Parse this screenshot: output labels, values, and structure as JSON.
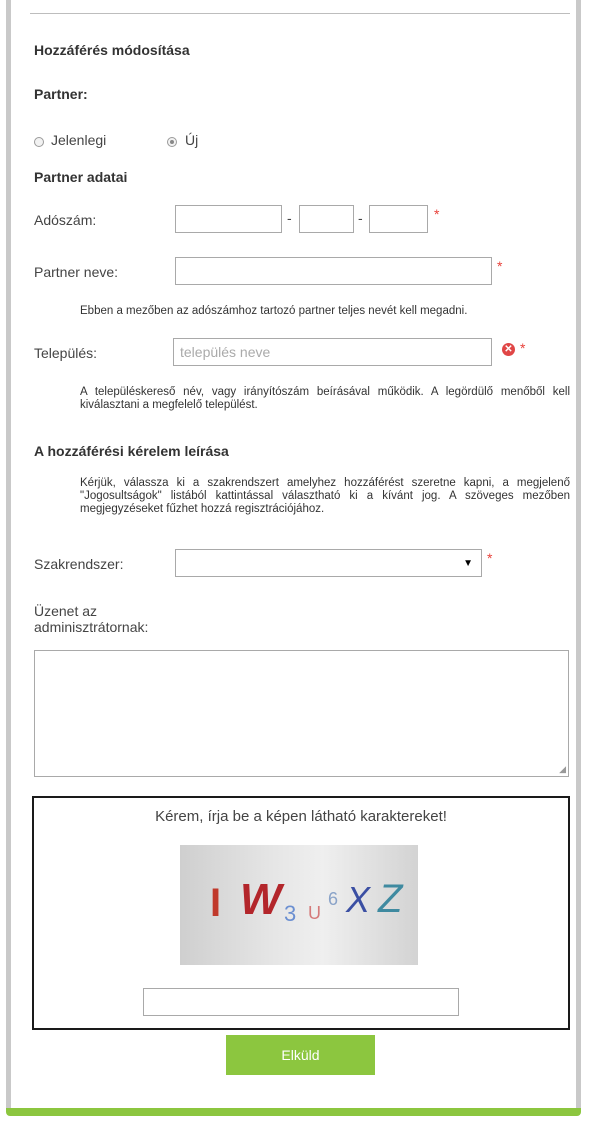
{
  "section_title": "Hozzáférés módosítása",
  "partner_heading": "Partner:",
  "partner_options": {
    "current": "Jelenlegi",
    "new": "Új",
    "selected": "new"
  },
  "partner_data_heading": "Partner adatai",
  "tax_number": {
    "label": "Adószám:",
    "separator": "-",
    "required_mark": "*"
  },
  "partner_name": {
    "label": "Partner neve:",
    "required_mark": "*",
    "help": "Ebben a mezőben az adószámhoz tartozó partner teljes nevét kell megadni."
  },
  "settlement": {
    "label": "Település:",
    "placeholder": "település neve",
    "required_mark": "*",
    "help": "A településkereső név, vagy irányítószám beírásával működik. A legördülő menőből kell kiválasztani a megfelelő települést."
  },
  "request_heading": "A hozzáférési kérelem leírása",
  "request_help": "Kérjük, válassza ki a szakrendszert amelyhez hozzáférést szeretne kapni, a megjelenő \"Jogosultságok\" listából kattintással választható ki a kívánt jog. A szöveges mezőben megjegyzéseket fűzhet hozzá regisztrációjához.",
  "system": {
    "label": "Szakrendszer:",
    "value": "",
    "required_mark": "*"
  },
  "message": {
    "label": "Üzenet az adminisztrátornak:",
    "value": ""
  },
  "captcha": {
    "prompt": "Kérem, írja be a képen látható karaktereket!",
    "chars": [
      {
        "text": "I",
        "color": "#c0392b"
      },
      {
        "text": "W",
        "color": "#b3262b"
      },
      {
        "text": "3",
        "color": "#6b8fd1"
      },
      {
        "text": "U",
        "color": "#d57a7a"
      },
      {
        "text": "6",
        "color": "#8aa3c8"
      },
      {
        "text": "X",
        "color": "#3b4fa3"
      },
      {
        "text": "Z",
        "color": "#3f8aa0"
      }
    ],
    "input_value": ""
  },
  "submit_label": "Elküld",
  "colors": {
    "accent": "#8cc63f",
    "required": "#e8413a",
    "error": "#e04646"
  }
}
